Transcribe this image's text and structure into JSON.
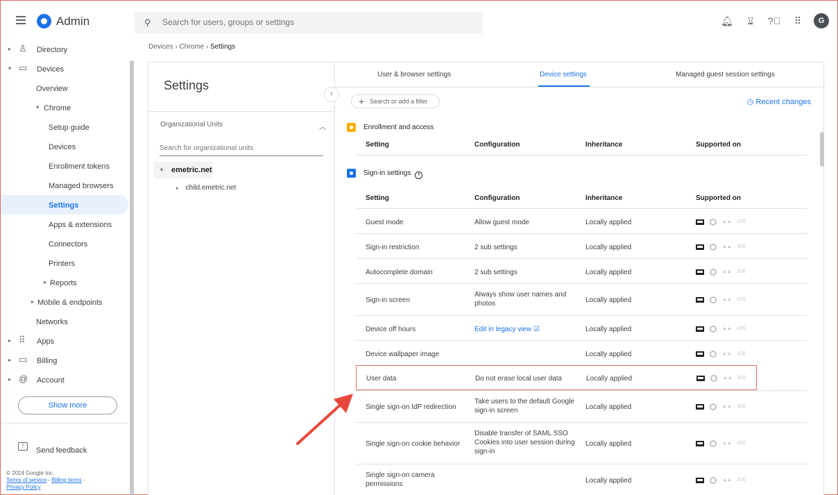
{
  "header": {
    "app_name": "Admin",
    "search_placeholder": "Search for users, groups or settings",
    "avatar_letter": "G"
  },
  "breadcrumb": [
    "Devices",
    "Chrome",
    "Settings"
  ],
  "sidebar": {
    "items": [
      {
        "label": "Directory"
      },
      {
        "label": "Devices"
      },
      {
        "label": "Overview"
      },
      {
        "label": "Chrome"
      },
      {
        "label": "Setup guide"
      },
      {
        "label": "Devices"
      },
      {
        "label": "Enrollment tokens"
      },
      {
        "label": "Managed browsers"
      },
      {
        "label": "Settings",
        "active": true
      },
      {
        "label": "Apps & extensions"
      },
      {
        "label": "Connectors"
      },
      {
        "label": "Printers"
      },
      {
        "label": "Reports"
      },
      {
        "label": "Mobile & endpoints"
      },
      {
        "label": "Networks"
      },
      {
        "label": "Apps"
      },
      {
        "label": "Billing"
      },
      {
        "label": "Account"
      }
    ],
    "show_more": "Show more",
    "send_feedback": "Send feedback",
    "copyright": "© 2024 Google Inc.",
    "terms": "Terms of service",
    "billing_terms": "Billing terms",
    "privacy": "Privacy Policy"
  },
  "org_panel": {
    "title": "Settings",
    "heading": "Organizational Units",
    "search_placeholder": "Search for organizational units",
    "root": "emetric.net",
    "child": "child.emetric.net"
  },
  "tabs": [
    "User & browser settings",
    "Device settings",
    "Managed guest session settings"
  ],
  "filter_placeholder": "Search or add a filter",
  "recent_changes": "Recent changes",
  "sections": {
    "enrollment": {
      "title": "Enrollment and access",
      "color": "#f9ab00"
    },
    "signin": {
      "title": "Sign-in settings",
      "color": "#1a73e8"
    }
  },
  "columns": [
    "Setting",
    "Configuration",
    "Inheritance",
    "Supported on"
  ],
  "platform_labels": {
    "ios": "iOS"
  },
  "rows": [
    {
      "setting": "Guest mode",
      "config": "Allow guest mode",
      "inherit": "Locally applied"
    },
    {
      "setting": "Sign-in restriction",
      "config": "2 sub settings",
      "inherit": "Locally applied"
    },
    {
      "setting": "Autocomplete domain",
      "config": "2 sub settings",
      "inherit": "Locally applied"
    },
    {
      "setting": "Sign-in screen",
      "config": "Always show user names and photos",
      "inherit": "Locally applied"
    },
    {
      "setting": "Device off hours",
      "config": "Edit in legacy view ☑",
      "inherit": "Locally applied"
    },
    {
      "setting": "Device wallpaper image",
      "config": "",
      "inherit": "Locally applied"
    },
    {
      "setting": "User data",
      "config": "Do not erase local user data",
      "inherit": "Locally applied"
    },
    {
      "setting": "Single sign-on IdP redirection",
      "config": "Take users to the default Google sign-in screen",
      "inherit": "Locally applied"
    },
    {
      "setting": "Single sign-on cookie behavior",
      "config": "Disable transfer of SAML SSO Cookies into user session during sign-in",
      "inherit": "Locally applied"
    },
    {
      "setting": "Single sign-on camera permissions",
      "config": "",
      "inherit": "Locally applied"
    }
  ],
  "colors": {
    "accent": "#1a73e8",
    "highlight": "#e06c5f"
  }
}
